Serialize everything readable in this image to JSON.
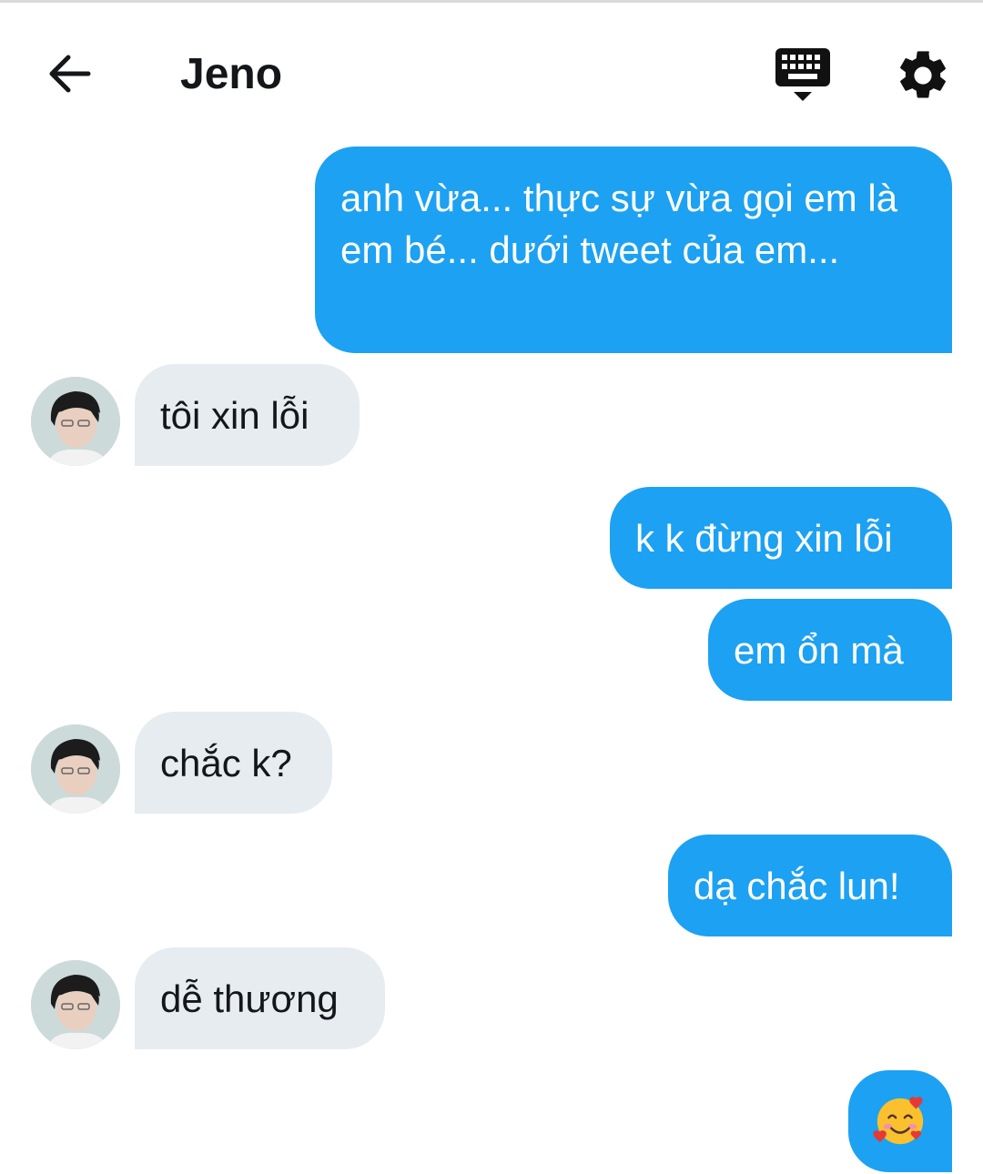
{
  "header": {
    "title": "Jeno",
    "back_icon": "arrow-left-icon",
    "keyboard_icon": "keyboard-icon",
    "settings_icon": "gear-icon"
  },
  "colors": {
    "sent_bubble": "#1da1f2",
    "received_bubble": "#e6ecf0",
    "sent_text": "#ffffff",
    "received_text": "#14171a"
  },
  "messages": [
    {
      "direction": "sent",
      "text": "anh vừa... thực sự vừa gọi em là em bé... dưới tweet của em..."
    },
    {
      "direction": "received",
      "text": "tôi xin lỗi"
    },
    {
      "direction": "sent",
      "text": "k k đừng xin lỗi"
    },
    {
      "direction": "sent",
      "text": "em ổn mà"
    },
    {
      "direction": "received",
      "text": "chắc k?"
    },
    {
      "direction": "sent",
      "text": "dạ chắc lun!"
    },
    {
      "direction": "received",
      "text": "dễ thương"
    },
    {
      "direction": "sent",
      "emoji": "smiling-face-with-hearts-icon"
    }
  ]
}
